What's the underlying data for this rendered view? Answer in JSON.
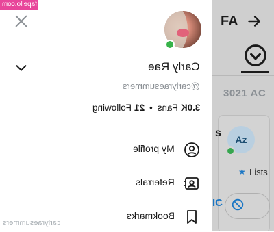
{
  "watermark": "fapello.com",
  "background": {
    "title": "FA",
    "count": "3021 AC",
    "card_initials": "Az",
    "card_letter": "s",
    "lists_label": "Lists",
    "btn_text": "IC"
  },
  "drawer": {
    "name": "Carly Rae",
    "handle": "@carlyraesummers",
    "stats": {
      "fans_count": "3.0K",
      "fans_label": "Fans",
      "following_count": "21",
      "following_label": "Following"
    },
    "menu": [
      {
        "label": "My profile",
        "icon": "user-circle-icon"
      },
      {
        "label": "Referrals",
        "icon": "referral-icon"
      },
      {
        "label": "Bookmarks",
        "icon": "bookmark-icon"
      }
    ],
    "footer_handle": "carlyraesummers"
  },
  "colors": {
    "online": "#37b34a",
    "watermark_bg": "#e8469a",
    "accent_blue": "#1a76c4"
  }
}
